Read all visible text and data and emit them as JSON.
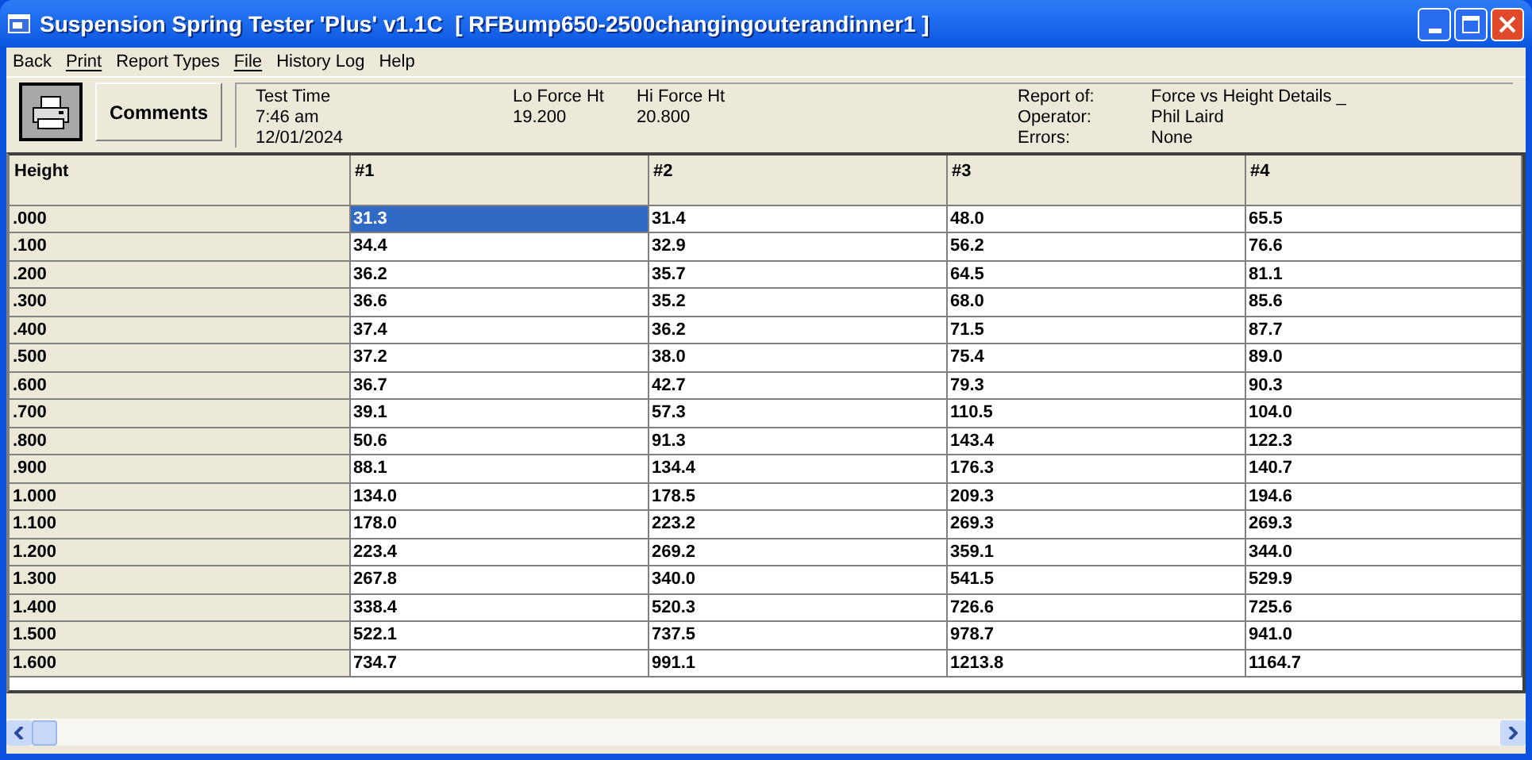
{
  "window": {
    "title": "Suspension Spring Tester 'Plus' v1.1C  [ RFBump650-2500changingouterandinner1 ]"
  },
  "menu": [
    {
      "label": "Back",
      "mnemonic": false
    },
    {
      "label": "Print",
      "mnemonic": true
    },
    {
      "label": "Report Types",
      "mnemonic": false
    },
    {
      "label": "File",
      "mnemonic": true
    },
    {
      "label": "History Log",
      "mnemonic": false
    },
    {
      "label": "Help",
      "mnemonic": false
    }
  ],
  "toolbar": {
    "comments_button": "Comments"
  },
  "info": {
    "test_time_label": "Test Time",
    "time": "7:46 am",
    "date": "12/01/2024",
    "lo_force_label": "Lo Force Ht",
    "lo_force": "19.200",
    "hi_force_label": "Hi Force Ht",
    "hi_force": "20.800",
    "details": [
      {
        "label": "Report of:",
        "value": "Force vs Height Details _"
      },
      {
        "label": "Operator:",
        "value": "Phil Laird"
      },
      {
        "label": "Errors:",
        "value": "None"
      }
    ]
  },
  "table": {
    "columns": [
      "Height",
      "#1",
      "#2",
      "#3",
      "#4"
    ],
    "rows": [
      {
        "cells": [
          {
            "text": ".000",
            "selected": false
          },
          {
            "text": "31.3",
            "selected": true
          },
          {
            "text": "31.4",
            "selected": false
          },
          {
            "text": "48.0",
            "selected": false
          },
          {
            "text": "65.5",
            "selected": false
          }
        ]
      },
      {
        "cells": [
          {
            "text": ".100",
            "selected": false
          },
          {
            "text": "34.4",
            "selected": false
          },
          {
            "text": "32.9",
            "selected": false
          },
          {
            "text": "56.2",
            "selected": false
          },
          {
            "text": "76.6",
            "selected": false
          }
        ]
      },
      {
        "cells": [
          {
            "text": ".200",
            "selected": false
          },
          {
            "text": "36.2",
            "selected": false
          },
          {
            "text": "35.7",
            "selected": false
          },
          {
            "text": "64.5",
            "selected": false
          },
          {
            "text": "81.1",
            "selected": false
          }
        ]
      },
      {
        "cells": [
          {
            "text": ".300",
            "selected": false
          },
          {
            "text": "36.6",
            "selected": false
          },
          {
            "text": "35.2",
            "selected": false
          },
          {
            "text": "68.0",
            "selected": false
          },
          {
            "text": "85.6",
            "selected": false
          }
        ]
      },
      {
        "cells": [
          {
            "text": ".400",
            "selected": false
          },
          {
            "text": "37.4",
            "selected": false
          },
          {
            "text": "36.2",
            "selected": false
          },
          {
            "text": "71.5",
            "selected": false
          },
          {
            "text": "87.7",
            "selected": false
          }
        ]
      },
      {
        "cells": [
          {
            "text": ".500",
            "selected": false
          },
          {
            "text": "37.2",
            "selected": false
          },
          {
            "text": "38.0",
            "selected": false
          },
          {
            "text": "75.4",
            "selected": false
          },
          {
            "text": "89.0",
            "selected": false
          }
        ]
      },
      {
        "cells": [
          {
            "text": ".600",
            "selected": false
          },
          {
            "text": "36.7",
            "selected": false
          },
          {
            "text": "42.7",
            "selected": false
          },
          {
            "text": "79.3",
            "selected": false
          },
          {
            "text": "90.3",
            "selected": false
          }
        ]
      },
      {
        "cells": [
          {
            "text": ".700",
            "selected": false
          },
          {
            "text": "39.1",
            "selected": false
          },
          {
            "text": "57.3",
            "selected": false
          },
          {
            "text": "110.5",
            "selected": false
          },
          {
            "text": "104.0",
            "selected": false
          }
        ]
      },
      {
        "cells": [
          {
            "text": ".800",
            "selected": false
          },
          {
            "text": "50.6",
            "selected": false
          },
          {
            "text": "91.3",
            "selected": false
          },
          {
            "text": "143.4",
            "selected": false
          },
          {
            "text": "122.3",
            "selected": false
          }
        ]
      },
      {
        "cells": [
          {
            "text": ".900",
            "selected": false
          },
          {
            "text": "88.1",
            "selected": false
          },
          {
            "text": "134.4",
            "selected": false
          },
          {
            "text": "176.3",
            "selected": false
          },
          {
            "text": "140.7",
            "selected": false
          }
        ]
      },
      {
        "cells": [
          {
            "text": "1.000",
            "selected": false
          },
          {
            "text": "134.0",
            "selected": false
          },
          {
            "text": "178.5",
            "selected": false
          },
          {
            "text": "209.3",
            "selected": false
          },
          {
            "text": "194.6",
            "selected": false
          }
        ]
      },
      {
        "cells": [
          {
            "text": "1.100",
            "selected": false
          },
          {
            "text": "178.0",
            "selected": false
          },
          {
            "text": "223.2",
            "selected": false
          },
          {
            "text": "269.3",
            "selected": false
          },
          {
            "text": "269.3",
            "selected": false
          }
        ]
      },
      {
        "cells": [
          {
            "text": "1.200",
            "selected": false
          },
          {
            "text": "223.4",
            "selected": false
          },
          {
            "text": "269.2",
            "selected": false
          },
          {
            "text": "359.1",
            "selected": false
          },
          {
            "text": "344.0",
            "selected": false
          }
        ]
      },
      {
        "cells": [
          {
            "text": "1.300",
            "selected": false
          },
          {
            "text": "267.8",
            "selected": false
          },
          {
            "text": "340.0",
            "selected": false
          },
          {
            "text": "541.5",
            "selected": false
          },
          {
            "text": "529.9",
            "selected": false
          }
        ]
      },
      {
        "cells": [
          {
            "text": "1.400",
            "selected": false
          },
          {
            "text": "338.4",
            "selected": false
          },
          {
            "text": "520.3",
            "selected": false
          },
          {
            "text": "726.6",
            "selected": false
          },
          {
            "text": "725.6",
            "selected": false
          }
        ]
      },
      {
        "cells": [
          {
            "text": "1.500",
            "selected": false
          },
          {
            "text": "522.1",
            "selected": false
          },
          {
            "text": "737.5",
            "selected": false
          },
          {
            "text": "978.7",
            "selected": false
          },
          {
            "text": "941.0",
            "selected": false
          }
        ]
      },
      {
        "cells": [
          {
            "text": "1.600",
            "selected": false
          },
          {
            "text": "734.7",
            "selected": false
          },
          {
            "text": "991.1",
            "selected": false
          },
          {
            "text": "1213.8",
            "selected": false
          },
          {
            "text": "1164.7",
            "selected": false
          }
        ]
      }
    ]
  }
}
